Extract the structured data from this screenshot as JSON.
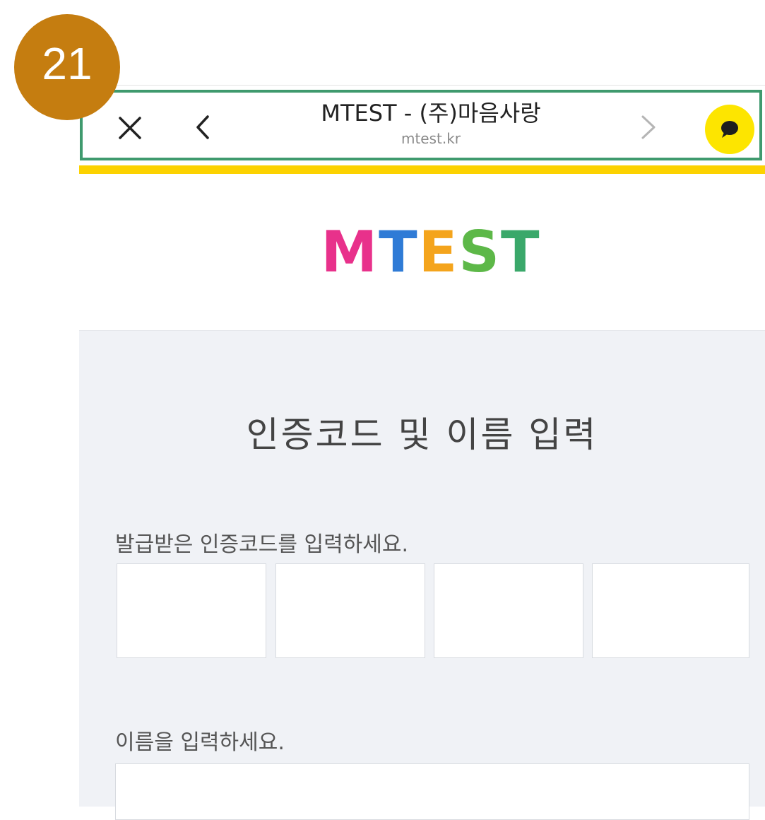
{
  "step_badge": "21",
  "browser": {
    "title": "MTEST - (주)마음사랑",
    "url": "mtest.kr",
    "progress_color": "#fcd200",
    "highlight_color": "#3f9a6e"
  },
  "icons": {
    "close": "close-icon",
    "back": "chevron-left-icon",
    "forward": "chevron-right-icon",
    "kakao": "kakao-talk-icon"
  },
  "logo": {
    "letters": [
      {
        "char": "M",
        "color": "#e8318b"
      },
      {
        "char": "T",
        "color": "#2f7bd6"
      },
      {
        "char": "E",
        "color": "#f4a41c"
      },
      {
        "char": "S",
        "color": "#5db848"
      },
      {
        "char": "T",
        "color": "#3aa86a"
      }
    ]
  },
  "form": {
    "title": "인증코드 및 이름 입력",
    "code_label": "발급받은 인증코드를 입력하세요.",
    "code_fields": [
      "",
      "",
      "",
      ""
    ],
    "name_label": "이름을 입력하세요.",
    "name_value": ""
  }
}
